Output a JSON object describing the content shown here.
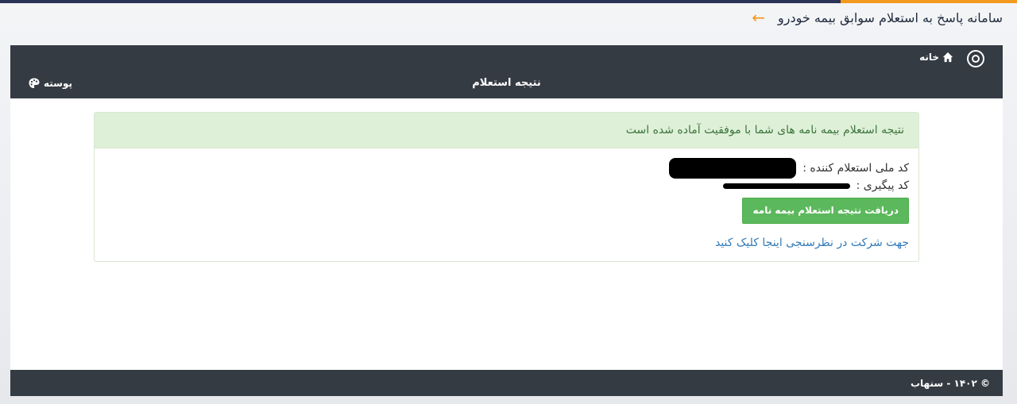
{
  "page": {
    "title": "سامانه پاسخ به استعلام سوابق بیمه خودرو",
    "back_icon": "arrow-left-icon"
  },
  "nav": {
    "home_label": "خانه",
    "section_title": "نتیجه استعلام",
    "skin_label": "پوسته",
    "logo_icon": "location-pin-icon",
    "home_icon": "home-icon",
    "skin_icon": "palette-icon"
  },
  "result": {
    "success_message": "نتیجه استعلام بیمه نامه های شما با موفقیت آماده شده است",
    "national_code_label": "کد ملی استعلام کننده :",
    "tracking_code_label": "کد پیگیری :",
    "download_button": "دریافت نتیجه استعلام بیمه نامه",
    "survey_link": "جهت شرکت در نظرسنجی اینجا کلیک کنید"
  },
  "footer": {
    "copyright": "© ۱۴۰۲ - سنهاب"
  },
  "colors": {
    "accent_orange": "#f39a1e",
    "navbar": "#353b43",
    "success_bg": "#dff0d8",
    "button_green": "#5cb85c",
    "link_blue": "#337ab7"
  }
}
